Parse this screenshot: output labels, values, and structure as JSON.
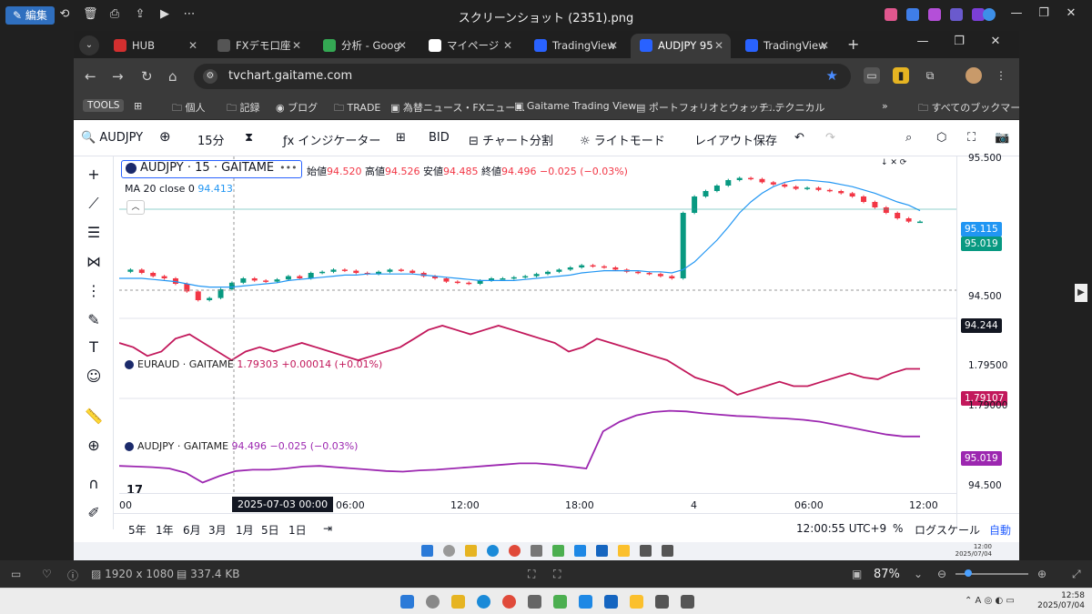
{
  "window": {
    "edit_label": "編集",
    "title": "スクリーンショット (2351).png"
  },
  "tabs": [
    {
      "label": "HUB",
      "color": "#d32f2f"
    },
    {
      "label": "FXデモ口座",
      "color": "#444444"
    },
    {
      "label": "分析 - Goog",
      "color": "#34a853"
    },
    {
      "label": "マイページ",
      "color": "#ffffff"
    },
    {
      "label": "TradingView",
      "color": "#2962ff"
    },
    {
      "label": "AUDJPY 95",
      "color": "#2962ff"
    },
    {
      "label": "TradingView",
      "color": "#2962ff"
    }
  ],
  "browser": {
    "url": "tvchart.gaitame.com",
    "bookmarks": [
      "TOOLS",
      "個人",
      "記録",
      "ブログ",
      "TRADE",
      "為替ニュース・FXニュー…",
      "Gaitame Trading View",
      "ポートフォリオとウォッチ…",
      "テクニカル",
      "»",
      "すべてのブックマーク"
    ]
  },
  "tv_toolbar": {
    "symbol": "AUDJPY",
    "interval": "15分",
    "indicators": "インジケーター",
    "bid": "BID",
    "split": "チャート分割",
    "light": "ライトモード",
    "save_layout": "レイアウト保存"
  },
  "legend": {
    "symbol": "AUDJPY · 15 · GAITAME",
    "open_k": "始値",
    "open": "94.520",
    "high_k": "高値",
    "high": "94.526",
    "low_k": "安値",
    "low": "94.485",
    "close_k": "終値",
    "close": "94.496",
    "change": "−0.025 (−0.03%)",
    "ma_label": "MA 20 close 0",
    "ma_value": "94.413"
  },
  "sub1": {
    "symbol": "EURAUD · GAITAME",
    "value": "1.79303",
    "change": "+0.00014 (+0.01%)",
    "axis": [
      "1.79500",
      "1.79000"
    ],
    "last": "1.79107"
  },
  "sub2": {
    "symbol": "AUDJPY · GAITAME",
    "value": "94.496",
    "change": "−0.025 (−0.03%)",
    "axis": [
      "94.500"
    ],
    "last": "95.019"
  },
  "price_axis": {
    "ticks": [
      "95.500",
      "94.500"
    ],
    "ma_label": "95.115",
    "last_label": "95.019",
    "cross_label": "94.244"
  },
  "time_axis": {
    "ticks": [
      "00",
      "06:00",
      "12:00",
      "18:00",
      "4",
      "06:00",
      "12:00"
    ],
    "crosshair": "2025-07-03   00:00"
  },
  "bottom": {
    "ranges": [
      "5年",
      "1年",
      "6月",
      "3月",
      "1月",
      "5日",
      "1日"
    ],
    "clock": "12:00:55 UTC+9",
    "pct": "%",
    "log": "ログスケール",
    "auto": "自動"
  },
  "viewer": {
    "dims": "1920 x 1080",
    "size": "337.4 KB",
    "zoom": "87%"
  },
  "taskbar": {
    "time": "12:58",
    "date": "2025/07/04",
    "inner_time": "12:00",
    "inner_date": "2025/07/04"
  },
  "chart_data": [
    {
      "type": "line",
      "title": "AUDJPY · 15 · GAITAME",
      "series": [
        {
          "name": "AUDJPY",
          "values": [
            94.56,
            94.58,
            94.55,
            94.52,
            94.5,
            94.45,
            94.38,
            94.3,
            94.32,
            94.4,
            94.46,
            94.5,
            94.48,
            94.47,
            94.49,
            94.52,
            94.5,
            94.55,
            94.56,
            94.58,
            94.57,
            94.55,
            94.54,
            94.56,
            94.58,
            94.57,
            94.55,
            94.52,
            94.5,
            94.47,
            94.46,
            94.45,
            94.48,
            94.5,
            94.5,
            94.51,
            94.52,
            94.54,
            94.56,
            94.58,
            94.6,
            94.62,
            94.61,
            94.6,
            94.58,
            94.56,
            94.55,
            94.54,
            94.52,
            94.5,
            95.1,
            95.25,
            95.3,
            95.35,
            95.4,
            95.42,
            95.41,
            95.38,
            95.36,
            95.34,
            95.32,
            95.33,
            95.31,
            95.3,
            95.28,
            95.25,
            95.2,
            95.15,
            95.1,
            95.05,
            95.02,
            95.02
          ]
        },
        {
          "name": "MA 20 close 0",
          "values": [
            94.5,
            94.5,
            94.5,
            94.49,
            94.48,
            94.47,
            94.45,
            94.43,
            94.42,
            94.42,
            94.42,
            94.43,
            94.44,
            94.45,
            94.46,
            94.48,
            94.49,
            94.5,
            94.51,
            94.52,
            94.53,
            94.53,
            94.54,
            94.54,
            94.54,
            94.54,
            94.54,
            94.53,
            94.52,
            94.51,
            94.5,
            94.49,
            94.48,
            94.48,
            94.48,
            94.48,
            94.49,
            94.5,
            94.51,
            94.52,
            94.53,
            94.55,
            94.56,
            94.57,
            94.57,
            94.57,
            94.57,
            94.56,
            94.56,
            94.55,
            94.58,
            94.65,
            94.75,
            94.85,
            94.97,
            95.1,
            95.2,
            95.28,
            95.34,
            95.38,
            95.4,
            95.4,
            95.39,
            95.38,
            95.36,
            95.34,
            95.31,
            95.28,
            95.24,
            95.2,
            95.17,
            95.12
          ]
        }
      ],
      "ylim": [
        94.2,
        95.55
      ],
      "grid": false
    },
    {
      "type": "line",
      "title": "EURAUD · GAITAME",
      "series": [
        {
          "name": "EURAUD",
          "values": [
            1.794,
            1.7935,
            1.7925,
            1.793,
            1.7945,
            1.795,
            1.794,
            1.793,
            1.792,
            1.793,
            1.7935,
            1.793,
            1.7935,
            1.794,
            1.7935,
            1.793,
            1.7925,
            1.792,
            1.7925,
            1.793,
            1.7935,
            1.7945,
            1.7955,
            1.796,
            1.7955,
            1.795,
            1.7955,
            1.796,
            1.7955,
            1.795,
            1.7945,
            1.794,
            1.793,
            1.7935,
            1.7945,
            1.794,
            1.7935,
            1.793,
            1.7925,
            1.792,
            1.791,
            1.79,
            1.7895,
            1.789,
            1.788,
            1.7885,
            1.789,
            1.7895,
            1.789,
            1.789,
            1.7895,
            1.79,
            1.7905,
            1.79,
            1.7898,
            1.7905,
            1.791,
            1.791
          ]
        }
      ],
      "ylim": [
        1.788,
        1.796
      ]
    },
    {
      "type": "line",
      "title": "AUDJPY · GAITAME",
      "series": [
        {
          "name": "AUDJPY",
          "values": [
            94.56,
            94.55,
            94.54,
            94.52,
            94.45,
            94.3,
            94.4,
            94.48,
            94.5,
            94.5,
            94.52,
            94.55,
            94.56,
            94.54,
            94.52,
            94.5,
            94.48,
            94.47,
            94.49,
            94.5,
            94.52,
            94.54,
            94.56,
            94.58,
            94.6,
            94.6,
            94.58,
            94.55,
            94.52,
            95.1,
            95.25,
            95.35,
            95.4,
            95.42,
            95.41,
            95.38,
            95.36,
            95.34,
            95.33,
            95.31,
            95.3,
            95.28,
            95.25,
            95.2,
            95.15,
            95.1,
            95.05,
            95.02,
            95.02
          ]
        }
      ],
      "ylim": [
        94.25,
        95.5
      ]
    }
  ]
}
